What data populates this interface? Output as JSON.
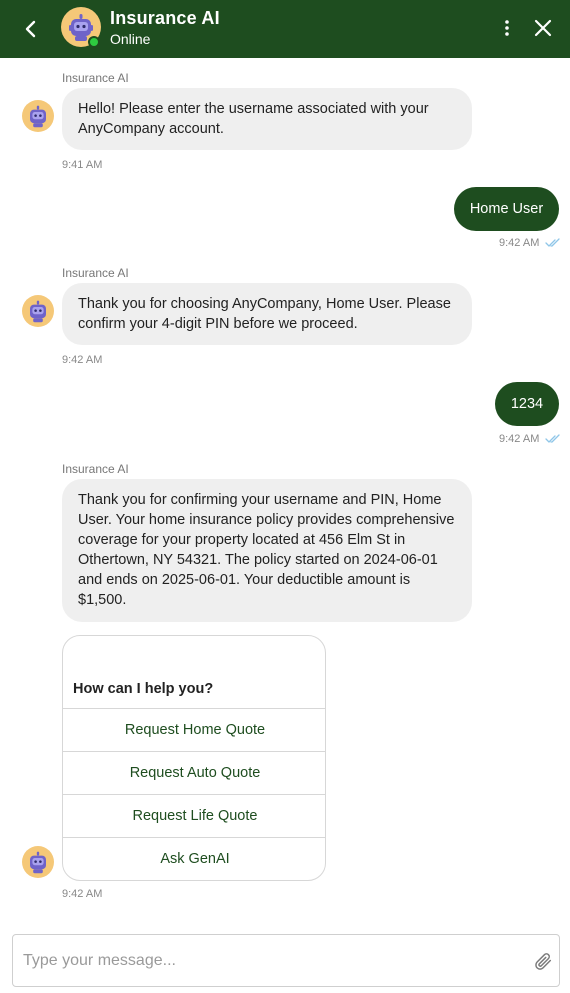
{
  "header": {
    "title": "Insurance AI",
    "status": "Online",
    "back_icon": "chevron-left-icon",
    "menu_icon": "kebab-menu-icon",
    "close_icon": "close-icon",
    "brand_color": "#1e4d1f",
    "online_color": "#2ecc40"
  },
  "messages": [
    {
      "sender": "Insurance AI",
      "text": "Hello! Please enter the username associated with your AnyCompany account.",
      "time": "9:41 AM"
    },
    {
      "text": "Home User",
      "time": "9:42 AM"
    },
    {
      "sender": "Insurance AI",
      "text": "Thank you for choosing AnyCompany, Home User. Please confirm your 4-digit PIN before we proceed.",
      "time": "9:42 AM"
    },
    {
      "text": "1234",
      "time": "9:42 AM"
    },
    {
      "sender": "Insurance AI",
      "text": "Thank you for confirming your username and PIN, Home User. Your home insurance policy provides comprehensive coverage for your property located at 456 Elm St in Othertown, NY 54321. The policy started on 2024-06-01 and ends on 2025-06-01. Your deductible amount is $1,500."
    }
  ],
  "menu": {
    "title": "How can I help you?",
    "options": [
      "Request Home Quote",
      "Request Auto Quote",
      "Request Life Quote",
      "Ask GenAI"
    ],
    "time": "9:42 AM"
  },
  "composer": {
    "placeholder": "Type your message...",
    "attach_icon": "paperclip-icon"
  }
}
